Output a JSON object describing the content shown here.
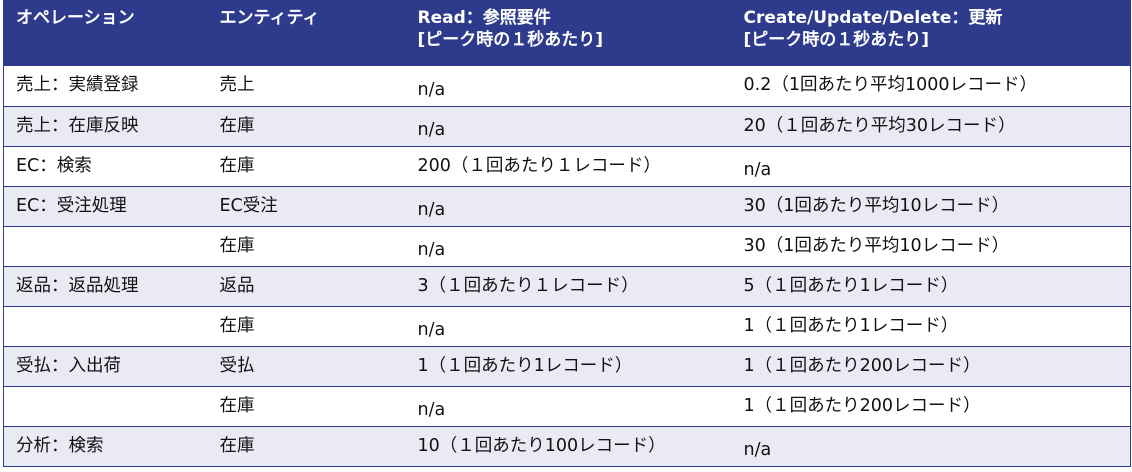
{
  "table": {
    "headers": [
      "オペレーション",
      "エンティティ",
      "Read：参照要件\n[ピーク時の１秒あたり]",
      "Create/Update/Delete：更新\n[ピーク時の１秒あたり]"
    ],
    "rows": [
      [
        "売上：実績登録",
        "売上",
        "n/a",
        "0.2（1回あたり平均1000レコード）"
      ],
      [
        "売上：在庫反映",
        "在庫",
        "n/a",
        "20（１回あたり平均30レコード）"
      ],
      [
        "EC：検索",
        "在庫",
        "200（１回あたり１レコード）",
        "n/a"
      ],
      [
        "EC：受注処理",
        "EC受注",
        "n/a",
        "30（1回あたり平均10レコード）"
      ],
      [
        "",
        "在庫",
        "n/a",
        "30（1回あたり平均10レコード）"
      ],
      [
        "返品：返品処理",
        "返品",
        "3（１回あたり１レコード）",
        "5（１回あたり1レコード）"
      ],
      [
        "",
        "在庫",
        "n/a",
        "1（１回あたり1レコード）"
      ],
      [
        "受払：入出荷",
        "受払",
        "1（１回あたり1レコード）",
        "1（１回あたり200レコード）"
      ],
      [
        "",
        "在庫",
        "n/a",
        "1（１回あたり200レコード）"
      ],
      [
        "分析：検索",
        "在庫",
        "10（１回あたり100レコード）",
        "n/a"
      ]
    ]
  },
  "colors": {
    "header_bg": "#2e3a8c",
    "header_text": "#ffffff",
    "stripe": "#e9eaf4"
  }
}
